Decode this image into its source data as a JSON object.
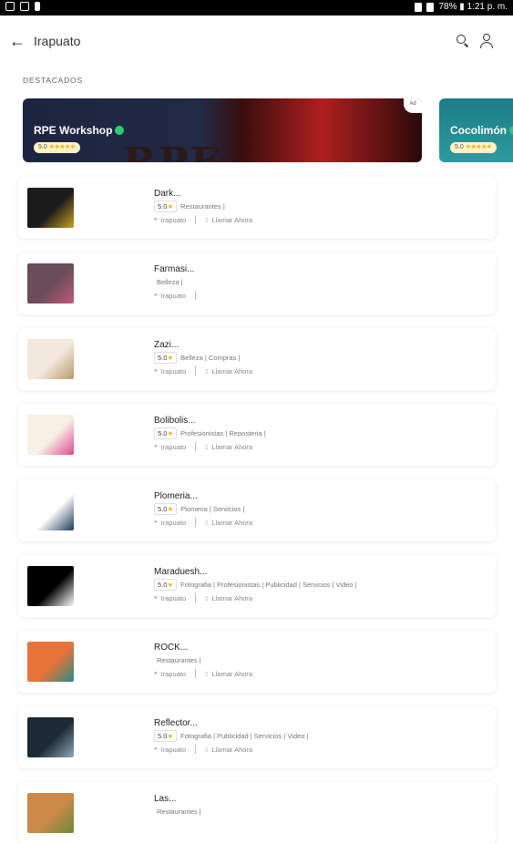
{
  "status_bar": {
    "right_text": "78% ▮ 1:21 p. m."
  },
  "app_bar": {
    "title": "Irapuato"
  },
  "featured_section": {
    "label": "DESTACADOS",
    "items": [
      {
        "name": "RPE Workshop",
        "rating": "5.0",
        "stars": "★★★★★",
        "ad_label": "Ad"
      },
      {
        "name": "Cocolimón",
        "rating": "5.0",
        "stars": "★★★★★"
      }
    ]
  },
  "listings": [
    {
      "name": "Dark...",
      "rating": "5.0",
      "categories": "Restaurantes |",
      "location": "Irapuato",
      "call": "Llamar Ahora",
      "thumb_color": "#1b1b1b",
      "thumb_accent": "#c9a227"
    },
    {
      "name": "Farmasi...",
      "rating": "",
      "categories": "Belleza |",
      "location": "Irapuato",
      "call": "",
      "thumb_color": "#6b4d5a",
      "thumb_accent": "#c45a7a"
    },
    {
      "name": "Zazi...",
      "rating": "5.0",
      "categories": "Belleza | Compras |",
      "location": "Irapuato",
      "call": "Llamar Ahora",
      "thumb_color": "#f2e8dc",
      "thumb_accent": "#b89a6a"
    },
    {
      "name": "Bolibolis...",
      "rating": "5.0",
      "categories": "Profesionistas | Reposteria |",
      "location": "Irapuato",
      "call": "Llamar Ahora",
      "thumb_color": "#f7f1e6",
      "thumb_accent": "#e0468f"
    },
    {
      "name": "Plomeria...",
      "rating": "5.0",
      "categories": "Plomeria | Servicios |",
      "location": "Irapuato",
      "call": "Llamar Ahora",
      "thumb_color": "#ffffff",
      "thumb_accent": "#1f3a5a"
    },
    {
      "name": "Maraduesh...",
      "rating": "5.0",
      "categories": "Fotografia | Profesionistas | Publicidad | Servicios | Video |",
      "location": "Irapuato",
      "call": "Llamar Ahora",
      "thumb_color": "#000000",
      "thumb_accent": "#ffffff"
    },
    {
      "name": "ROCK...",
      "rating": "",
      "categories": "Restaurantes |",
      "location": "Irapuato",
      "call": "Llamar Ahora",
      "thumb_color": "#e8743a",
      "thumb_accent": "#2a8a8a"
    },
    {
      "name": "Reflector...",
      "rating": "5.0",
      "categories": "Fotografia | Publicidad | Servicios | Video |",
      "location": "Irapuato",
      "call": "Llamar Ahora",
      "thumb_color": "#1c2a35",
      "thumb_accent": "#8fa8b8"
    },
    {
      "name": "Las...",
      "rating": "",
      "categories": "Restaurantes |",
      "location": "",
      "call": "",
      "thumb_color": "#c98a4a",
      "thumb_accent": "#6a8a3a"
    }
  ]
}
